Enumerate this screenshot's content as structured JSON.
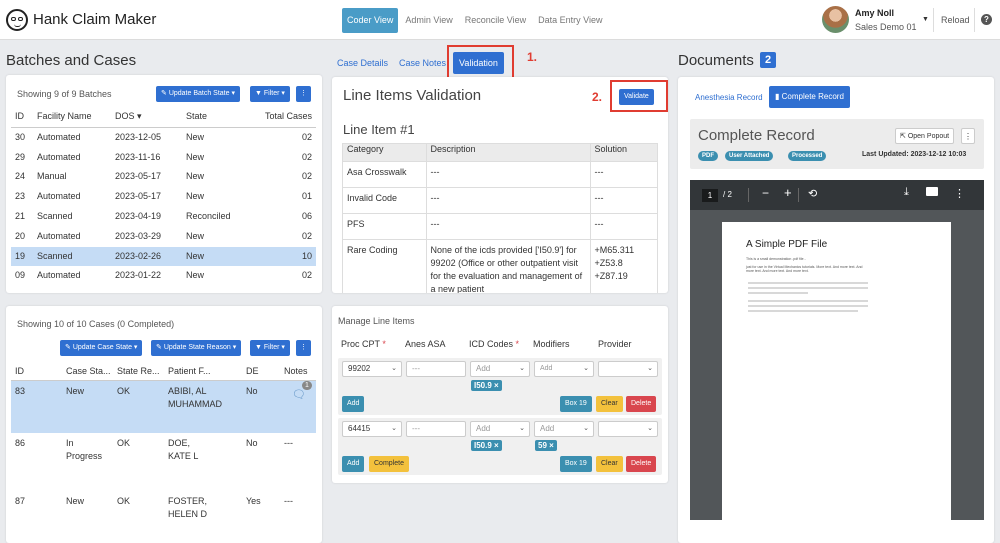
{
  "app": {
    "title": "Hank Claim Maker"
  },
  "nav": {
    "items": [
      "Coder View",
      "Admin View",
      "Reconcile View",
      "Data Entry View"
    ]
  },
  "user": {
    "name": "Amy Noll",
    "org": "Sales Demo 01",
    "reload": "Reload",
    "help": "?"
  },
  "left": {
    "title": "Batches and Cases",
    "batches": {
      "showing": "Showing 9 of 9 Batches",
      "update_btn": "Update Batch State",
      "filter_btn": "Filter",
      "more_btn": "⋮",
      "headers": [
        "ID",
        "Facility Name",
        "DOS",
        "State",
        "Total Cases"
      ],
      "rows": [
        [
          "30",
          "Automated",
          "2023-12-05",
          "New",
          "02"
        ],
        [
          "29",
          "Automated",
          "2023-11-16",
          "New",
          "02"
        ],
        [
          "24",
          "Manual",
          "2023-05-17",
          "New",
          "02"
        ],
        [
          "23",
          "Automated",
          "2023-05-17",
          "New",
          "01"
        ],
        [
          "21",
          "Scanned",
          "2023-04-19",
          "Reconciled",
          "06"
        ],
        [
          "20",
          "Automated",
          "2023-03-29",
          "New",
          "02"
        ],
        [
          "19",
          "Scanned",
          "2023-02-26",
          "New",
          "10"
        ],
        [
          "09",
          "Automated",
          "2023-01-22",
          "New",
          "02"
        ]
      ]
    },
    "cases": {
      "showing": "Showing 10 of 10 Cases (0 Completed)",
      "update_case_btn": "Update Case State",
      "update_reason_btn": "Update State Reason",
      "filter_btn": "Filter",
      "more_btn": "⋮",
      "headers": [
        "ID",
        "Case Sta...",
        "State Re...",
        "Patient F...",
        "DE",
        "Notes"
      ],
      "rows": [
        {
          "id": "83",
          "case": "New",
          "state": "OK",
          "patient": "ABIBI, AL MUHAMMAD",
          "de": "No",
          "notes": "",
          "note_count": "1"
        },
        {
          "id": "86",
          "case": "In Progress",
          "state": "OK",
          "patient": "DOE, KATE L",
          "de": "No",
          "notes": "---"
        },
        {
          "id": "87",
          "case": "New",
          "state": "OK",
          "patient": "FOSTER, HELEN D",
          "de": "Yes",
          "notes": "---"
        }
      ]
    }
  },
  "middle": {
    "tabs": [
      "Case Details",
      "Case Notes",
      "Validation"
    ],
    "annot1": "1.",
    "annot2": "2.",
    "validation": {
      "title": "Line Items Validation",
      "validate_btn": "Validate",
      "item_title": "Line Item #1",
      "headers": [
        "Category",
        "Description",
        "Solution"
      ],
      "rows": [
        {
          "category": "Asa Crosswalk",
          "description": "---",
          "solution": "---"
        },
        {
          "category": "Invalid Code",
          "description": "---",
          "solution": "---"
        },
        {
          "category": "PFS",
          "description": "---",
          "solution": "---"
        },
        {
          "category": "Rare Coding",
          "description": "None of the icds provided ['I50.9'] for 99202 (Office or other outpatient visit for the evaluation and management of a new patient",
          "solution": "+M65.311 +Z53.8 +Z87.19"
        }
      ]
    },
    "manage": {
      "title": "Manage Line Items",
      "headers": [
        "Proc CPT",
        "Anes ASA",
        "ICD Codes",
        "Modifiers",
        "Provider"
      ],
      "required": "*",
      "lines": [
        {
          "cpt": "99202",
          "asa": "---",
          "icd_ph": "Add",
          "mod_ph": "Add",
          "icd_chip": "I50.9 ×",
          "mod_chip": "",
          "add": "Add",
          "complete": "",
          "box19": "Box 19",
          "clear": "Clear",
          "delete": "Delete"
        },
        {
          "cpt": "64415",
          "asa": "---",
          "icd_ph": "Add",
          "mod_ph": "Add",
          "icd_chip": "I50.9 ×",
          "mod_chip": "59 ×",
          "add": "Add",
          "complete": "Complete",
          "box19": "Box 19",
          "clear": "Clear",
          "delete": "Delete"
        }
      ]
    }
  },
  "right": {
    "title": "Documents",
    "count": "2",
    "tabs": [
      "Anesthesia Record",
      "Complete Record"
    ],
    "record": {
      "title": "Complete Record",
      "popout": "Open Popout",
      "badges": [
        "PDF",
        "User Attached",
        "Processed"
      ],
      "updated": "Last Updated: 2023-12-12 10:03"
    },
    "pdf": {
      "page": "1",
      "of": "/ 2",
      "doc_title": "A Simple PDF File",
      "line1": "This is a small demonstration .pdf file -",
      "line2": "just for use in the Virtual Mechanics tutorials. More text. And more text. And more text. And more text. And more text."
    }
  },
  "colors": {
    "accent": "#2f6fd1",
    "teal": "#3b8fb0",
    "annotation": "#e03c31",
    "selected_row": "#c5dcf5"
  }
}
